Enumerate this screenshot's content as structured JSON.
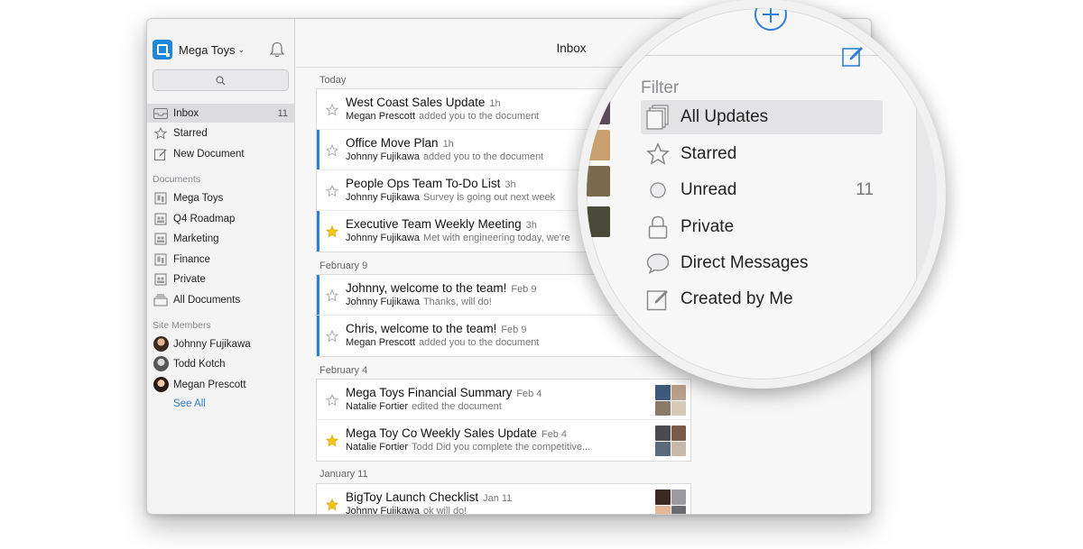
{
  "org": {
    "name": "Mega Toys"
  },
  "sidebar": {
    "top_items": [
      {
        "label": "Inbox",
        "count": "11",
        "icon": "inbox-icon"
      },
      {
        "label": "Starred",
        "icon": "star-icon"
      },
      {
        "label": "New Document",
        "icon": "edit-icon"
      }
    ],
    "documents_label": "Documents",
    "documents": [
      {
        "label": "Mega Toys",
        "icon": "building-icon"
      },
      {
        "label": "Q4 Roadmap",
        "icon": "folder-people-icon"
      },
      {
        "label": "Marketing",
        "icon": "folder-people-icon"
      },
      {
        "label": "Finance",
        "icon": "building-icon"
      },
      {
        "label": "Private",
        "icon": "folder-people-icon"
      },
      {
        "label": "All Documents",
        "icon": "stack-icon"
      }
    ],
    "members_label": "Site Members",
    "members": [
      {
        "label": "Johnny Fujikawa"
      },
      {
        "label": "Todd Kotch"
      },
      {
        "label": "Megan Prescott"
      }
    ],
    "see_all": "See All"
  },
  "inbox": {
    "title": "Inbox",
    "groups": [
      {
        "date": "Today",
        "messages": [
          {
            "subject": "West Coast Sales Update",
            "time": "1h",
            "sender": "Megan Prescott",
            "snippet": "added you to the document",
            "starred": false,
            "unread": false
          },
          {
            "subject": "Office Move Plan",
            "time": "1h",
            "sender": "Johnny Fujikawa",
            "snippet": "added you to the document",
            "starred": false,
            "unread": true
          },
          {
            "subject": "People Ops Team To-Do List",
            "time": "3h",
            "sender": "Johnny Fujikawa",
            "snippet": "Survey is going out next week",
            "starred": false,
            "unread": false
          },
          {
            "subject": "Executive Team Weekly Meeting",
            "time": "3h",
            "sender": "Johnny Fujikawa",
            "snippet": "Met with engineering today, we're",
            "starred": true,
            "unread": true
          }
        ]
      },
      {
        "date": "February 9",
        "messages": [
          {
            "subject": "Johnny, welcome to the team!",
            "time": "Feb 9",
            "sender": "Johnny Fujikawa",
            "snippet": "Thanks, will do!",
            "starred": false,
            "unread": true
          },
          {
            "subject": "Chris, welcome to the team!",
            "time": "Feb 9",
            "sender": "Megan Prescott",
            "snippet": "added you to the document",
            "starred": false,
            "unread": true
          }
        ]
      },
      {
        "date": "February 4",
        "messages": [
          {
            "subject": "Mega Toys Financial Summary",
            "time": "Feb 4",
            "sender": "Natalie Fortier",
            "snippet": "edited the document",
            "starred": false,
            "unread": false
          },
          {
            "subject": "Mega Toy Co Weekly Sales Update",
            "time": "Feb 4",
            "sender": "Natalie Fortier",
            "snippet": "Todd Did you complete the competitive...",
            "starred": true,
            "unread": false
          }
        ]
      },
      {
        "date": "January 11",
        "messages": [
          {
            "subject": "BigToy Launch Checklist",
            "time": "Jan 11",
            "sender": "Johnny Fujikawa",
            "snippet": "ok will do!",
            "starred": true,
            "unread": false
          }
        ]
      }
    ]
  },
  "filter": {
    "title": "Filter",
    "items": [
      {
        "label": "All Updates",
        "icon": "documents-icon",
        "active": true
      },
      {
        "label": "Starred",
        "icon": "star-icon"
      },
      {
        "label": "Unread",
        "icon": "circle-icon",
        "count": "11"
      },
      {
        "label": "Private",
        "icon": "lock-icon"
      },
      {
        "label": "Direct Messages",
        "icon": "chat-bubble-icon"
      },
      {
        "label": "Created by Me",
        "icon": "edit-icon"
      }
    ]
  },
  "colors": {
    "accent": "#2f7fd6",
    "star_active": "#f5c518",
    "unread_bar": "#2f7fd6"
  }
}
